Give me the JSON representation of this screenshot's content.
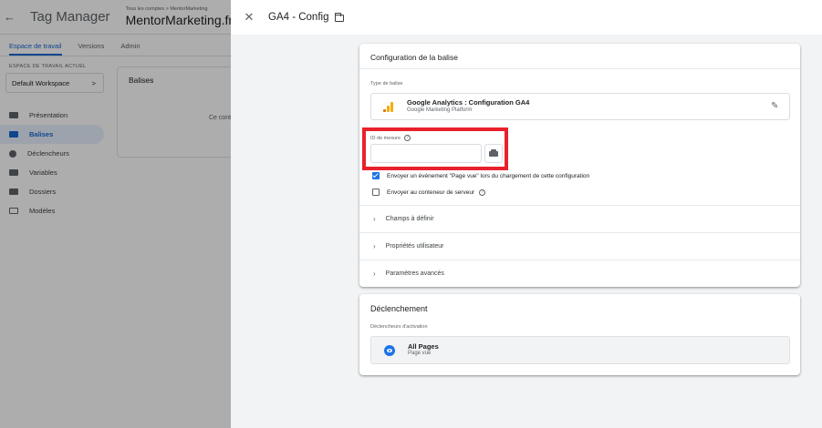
{
  "app": {
    "back_glyph": "←",
    "title": "Tag Manager",
    "account_path": "Tous les comptes > MentorMarketing",
    "account_name": "MentorMarketing.fr",
    "account_caret": "▾"
  },
  "tabs": [
    {
      "label": "Espace de travail",
      "active": true
    },
    {
      "label": "Versions",
      "active": false
    },
    {
      "label": "Admin",
      "active": false
    }
  ],
  "workspace": {
    "section_label": "ESPACE DE TRAVAIL ACTUEL",
    "name": "Default Workspace",
    "chevron": ">"
  },
  "nav": [
    {
      "label": "Présentation",
      "icon": "briefcase-icon",
      "active": false
    },
    {
      "label": "Balises",
      "icon": "tag-icon",
      "active": true
    },
    {
      "label": "Déclencheurs",
      "icon": "trigger-icon",
      "active": false
    },
    {
      "label": "Variables",
      "icon": "variables-icon",
      "active": false
    },
    {
      "label": "Dossiers",
      "icon": "folder-icon",
      "active": false
    },
    {
      "label": "Modèles",
      "icon": "template-icon",
      "active": false
    }
  ],
  "balises_card": {
    "title": "Balises",
    "empty_text": "Ce conte"
  },
  "panel": {
    "close_glyph": "✕",
    "title": "GA4 - Config"
  },
  "config": {
    "header": "Configuration de la balise",
    "type_label": "Type de balise",
    "type_name": "Google Analytics : Configuration GA4",
    "type_platform": "Google Marketing Platform",
    "edit_glyph": "✎",
    "measurement_id_label": "ID de mesure",
    "measurement_id_value": "",
    "help_glyph": "?",
    "checkbox_pageview": {
      "label": "Envoyer un événement \"Page vue\" lors du chargement de cette configuration",
      "checked": true
    },
    "checkbox_server": {
      "label": "Envoyer au conteneur de serveur",
      "checked": false
    },
    "expanders": [
      {
        "label": "Champs à définir"
      },
      {
        "label": "Propriétés utilisateur"
      },
      {
        "label": "Paramètres avancés"
      }
    ],
    "chevron_glyph": "›"
  },
  "trigger": {
    "header": "Déclenchement",
    "sub_label": "Déclencheurs d'activation",
    "name": "All Pages",
    "kind": "Page vue"
  },
  "colors": {
    "accent": "#1a73e8",
    "highlight": "#e8212b",
    "ga_orange": "#f9ab00"
  }
}
